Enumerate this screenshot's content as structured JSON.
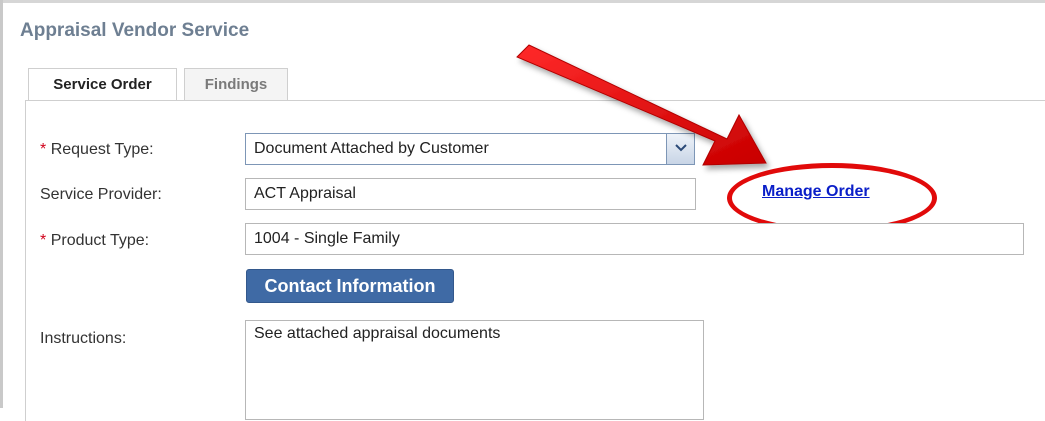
{
  "app": {
    "title": "Appraisal Vendor Service"
  },
  "tabs": [
    {
      "label": "Service Order",
      "active": true
    },
    {
      "label": "Findings",
      "active": false
    }
  ],
  "form": {
    "request_type": {
      "label": "Request Type:",
      "required": "*",
      "value": "Document Attached by Customer"
    },
    "service_provider": {
      "label": "Service Provider:",
      "value": "ACT Appraisal"
    },
    "manage_order": {
      "label": "Manage Order"
    },
    "product_type": {
      "label": "Product Type:",
      "required": "*",
      "value": "1004 - Single Family"
    },
    "contact_button": {
      "label": "Contact Information"
    },
    "instructions": {
      "label": "Instructions:",
      "value": "See attached appraisal documents"
    }
  },
  "colors": {
    "accent": "#3f6aa5",
    "link": "#0a1ec8",
    "annotation": "#e10a0a",
    "title": "#6e7f92"
  },
  "icons": {
    "select": "chevron-down-icon",
    "annotation": "arrow-annotation"
  }
}
